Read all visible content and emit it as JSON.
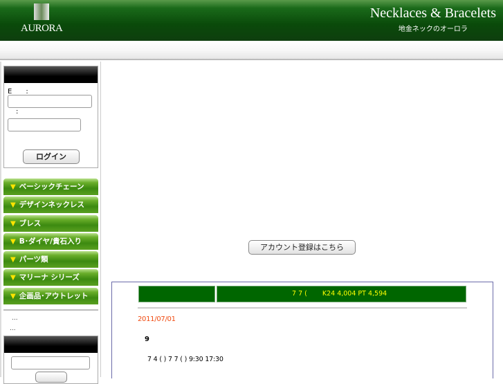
{
  "header": {
    "logo_text": "AURORA",
    "brand_en": "Necklaces & Bracelets",
    "brand_jp": "地金ネックのオーロラ"
  },
  "login": {
    "email_label": "E　　:",
    "password_label": ":",
    "login_button": "ログイン"
  },
  "menu": [
    {
      "label": "ベーシックチェーン"
    },
    {
      "label": "デザインネックレス"
    },
    {
      "label": "ブレス"
    },
    {
      "label": "B･ダイヤ/貴石入り"
    },
    {
      "label": "パーツ類"
    },
    {
      "label": "マリーナ シリーズ"
    },
    {
      "label": "企画品･アウトレット"
    }
  ],
  "menu_marker": "▼",
  "links": [
    "...",
    "..."
  ],
  "register_button": "アカウント登録はこちら",
  "price_bar": {
    "left": "",
    "right": "7 7 (　　 K24 4,004 PT 4,594"
  },
  "news": {
    "date": "2011/07/01",
    "title": "9",
    "body": "7 4 ( ) 7 7 ( ) 9:30 17:30"
  }
}
